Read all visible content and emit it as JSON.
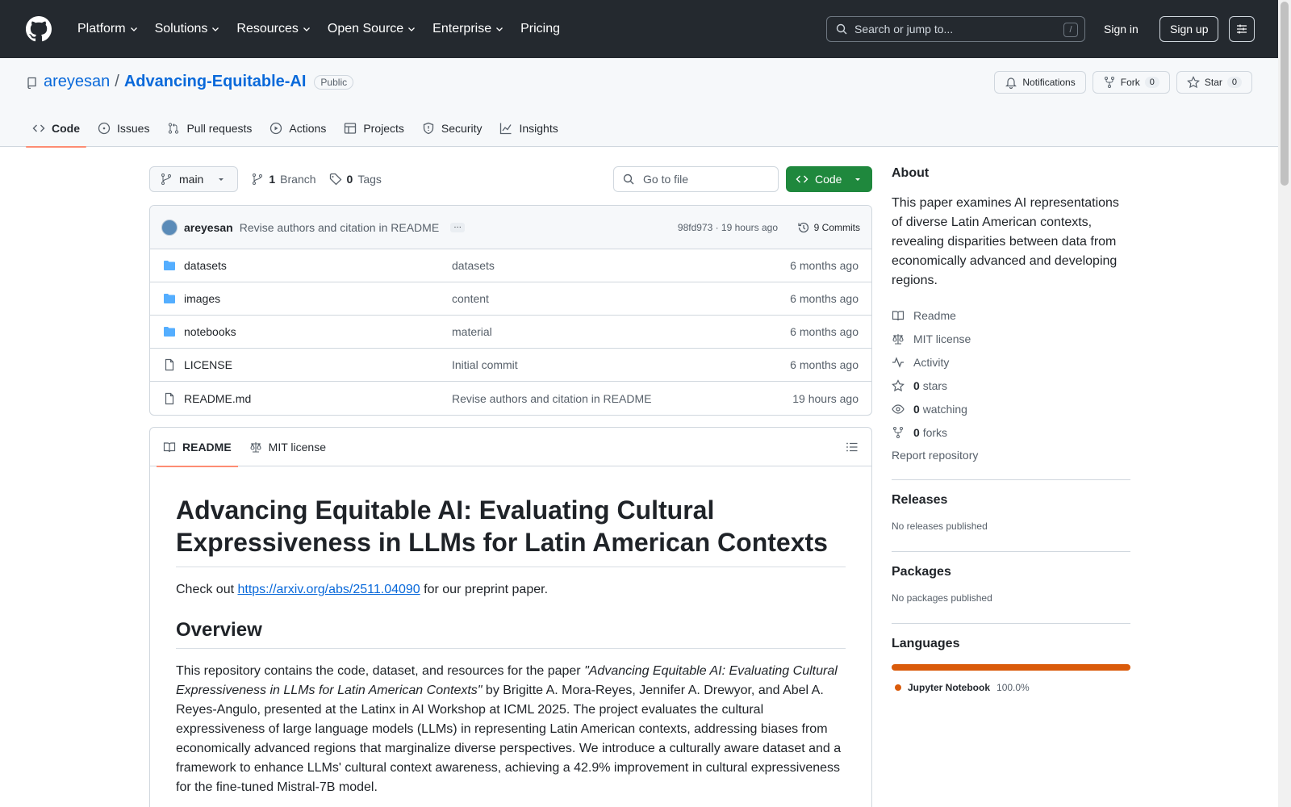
{
  "header": {
    "nav": [
      "Platform",
      "Solutions",
      "Resources",
      "Open Source",
      "Enterprise",
      "Pricing"
    ],
    "search_placeholder": "Search or jump to...",
    "search_shortcut": "/",
    "sign_in": "Sign in",
    "sign_up": "Sign up"
  },
  "repo": {
    "owner": "areyesan",
    "separator": "/",
    "name": "Advancing-Equitable-AI",
    "visibility": "Public",
    "notifications_label": "Notifications",
    "fork_label": "Fork",
    "fork_count": "0",
    "star_label": "Star",
    "star_count": "0",
    "tabs": [
      {
        "label": "Code",
        "icon": "code-icon"
      },
      {
        "label": "Issues",
        "icon": "issue-icon"
      },
      {
        "label": "Pull requests",
        "icon": "pull-request-icon"
      },
      {
        "label": "Actions",
        "icon": "play-icon"
      },
      {
        "label": "Projects",
        "icon": "table-icon"
      },
      {
        "label": "Security",
        "icon": "shield-icon"
      },
      {
        "label": "Insights",
        "icon": "graph-icon"
      }
    ]
  },
  "toolbar": {
    "branch": "main",
    "branch_count": "1",
    "branch_label": "Branch",
    "tag_count": "0",
    "tag_label": "Tags",
    "goto_placeholder": "Go to file",
    "code_button": "Code"
  },
  "commit": {
    "author": "areyesan",
    "message": "Revise authors and citation in README",
    "ellipsis": "…",
    "sha_time": "98fd973 · 19 hours ago",
    "commits_label": "9 Commits"
  },
  "files": [
    {
      "type": "folder",
      "name": "datasets",
      "message": "datasets",
      "time": "6 months ago"
    },
    {
      "type": "folder",
      "name": "images",
      "message": "content",
      "time": "6 months ago"
    },
    {
      "type": "folder",
      "name": "notebooks",
      "message": "material",
      "time": "6 months ago"
    },
    {
      "type": "file",
      "name": "LICENSE",
      "message": "Initial commit",
      "time": "6 months ago"
    },
    {
      "type": "file",
      "name": "README.md",
      "message": "Revise authors and citation in README",
      "time": "19 hours ago"
    }
  ],
  "readme": {
    "tab_readme": "README",
    "tab_license": "MIT license",
    "title": "Advancing Equitable AI: Evaluating Cultural Expressiveness in LLMs for Latin American Contexts",
    "check_prefix": "Check out ",
    "check_link": "https://arxiv.org/abs/2511.04090",
    "check_suffix": " for our preprint paper.",
    "overview_heading": "Overview",
    "overview_prefix": "This repository contains the code, dataset, and resources for the paper ",
    "overview_italic": "\"Advancing Equitable AI: Evaluating Cultural Expressiveness in LLMs for Latin American Contexts\"",
    "overview_suffix": " by Brigitte A. Mora-Reyes, Jennifer A. Drewyor, and Abel A. Reyes-Angulo, presented at the Latinx in AI Workshop at ICML 2025. The project evaluates the cultural expressiveness of large language models (LLMs) in representing Latin American contexts, addressing biases from economically advanced regions that marginalize diverse perspectives. We introduce a culturally aware dataset and a framework to enhance LLMs' cultural context awareness, achieving a 42.9% improvement in cultural expressiveness for the fine-tuned Mistral-7B model."
  },
  "sidebar": {
    "about_heading": "About",
    "description": "This paper examines AI representations of diverse Latin American contexts, revealing disparities between data from economically advanced and developing regions.",
    "readme": "Readme",
    "license": "MIT license",
    "activity": "Activity",
    "stars_count": "0",
    "stars_label": "stars",
    "watching_count": "0",
    "watching_label": "watching",
    "forks_count": "0",
    "forks_label": "forks",
    "report": "Report repository",
    "releases_heading": "Releases",
    "releases_text": "No releases published",
    "packages_heading": "Packages",
    "packages_text": "No packages published",
    "languages_heading": "Languages",
    "language_name": "Jupyter Notebook",
    "language_pct": "100.0%",
    "language_color": "#DA5B0B"
  },
  "colors": {
    "header_bg": "#24292f",
    "link": "#0969da",
    "code_button": "#1f883d",
    "active_tab_underline": "#fd8c73"
  }
}
